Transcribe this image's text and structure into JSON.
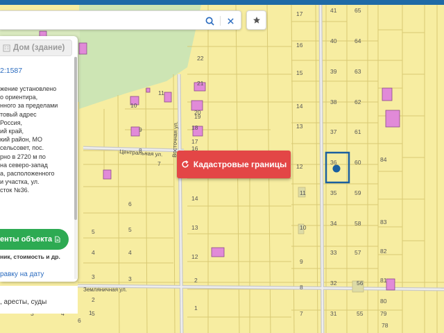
{
  "search": {
    "value": "",
    "placeholder": ""
  },
  "icons": {
    "search": "search-icon",
    "clear": "close-icon",
    "star": "star-icon",
    "house": "house-icon",
    "refresh": "refresh-icon",
    "document": "document-icon",
    "marker": "location-marker-icon"
  },
  "panel": {
    "house_label": "Дом (здание)",
    "cad_number": "2:1587",
    "location_lines": [
      "жение установлено",
      "о ориентира,",
      "нного за пределами",
      "товый адрес",
      "Россия,",
      "ий край,",
      "кий район, МО",
      "сельсовет, пос.",
      "рно в 2720 м по",
      "на северо-запад",
      "а, расположенного",
      "и участка, ул.",
      "сток №36."
    ],
    "docs_button": "енты объекта",
    "docs_sub": "ник, стоимость и др.",
    "date_link": "равку на дату",
    "arrests_line": ", аресты, суды"
  },
  "map": {
    "cadastral_button": "Кадастровые границы",
    "streets": [
      "Центральная ул.",
      "Восточная ул.",
      "Земляничная ул."
    ],
    "plot_labels": [
      "17",
      "16",
      "15",
      "14",
      "13",
      "12",
      "11",
      "10",
      "9",
      "8",
      "7",
      "41",
      "40",
      "39",
      "38",
      "37",
      "36",
      "35",
      "34",
      "33",
      "32",
      "31",
      "65",
      "64",
      "63",
      "62",
      "61",
      "60",
      "59",
      "58",
      "57",
      "56",
      "55",
      "84",
      "83",
      "82",
      "81",
      "80",
      "79",
      "78",
      "22",
      "21",
      "20",
      "19",
      "18",
      "17",
      "16",
      "15",
      "14",
      "13",
      "12",
      "11",
      "10",
      "9",
      "8",
      "7",
      "6",
      "5",
      "4",
      "3",
      "2",
      "1",
      "5",
      "4",
      "3",
      "2",
      "1",
      "3",
      "4",
      "5",
      "6"
    ]
  },
  "colors": {
    "plot_fill": "#f7eda1",
    "plot_border": "#d8c974",
    "building": "#e18ad8",
    "building_border": "#8a4a8a",
    "selection": "#1a5fa0",
    "red_button": "#e34646",
    "green_button": "#2daa52",
    "link": "#2a6bbf",
    "top_bar": "#1f6aa6"
  }
}
